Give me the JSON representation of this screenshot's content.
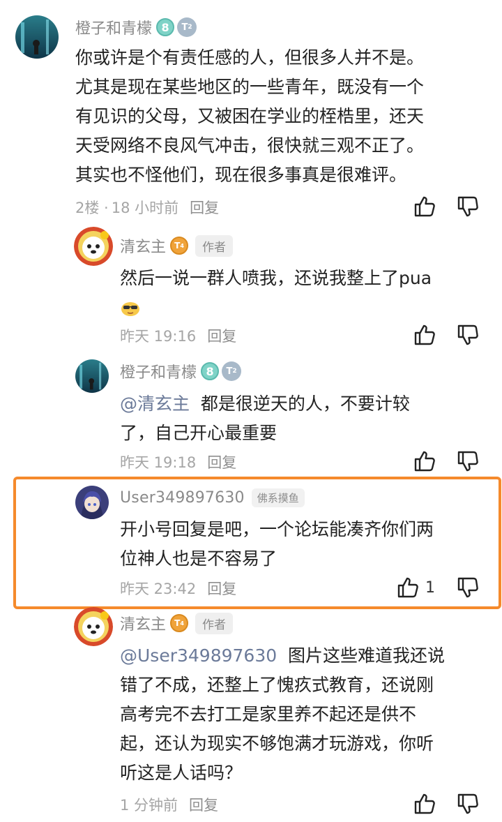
{
  "comments": [
    {
      "username": "橙子和青檬",
      "level": "8",
      "tier": "2",
      "lines": [
        "你或许是个有责任感的人，但很多人并不是。",
        "尤其是现在某些地区的一些青年，既没有一个",
        "有见识的父母，又被困在学业的桎梏里，还天",
        "天受网络不良风气冲击，很快就三观不正了。",
        "其实也不怪他们，现在很多事真是很难评。"
      ],
      "floor": "2楼 ·",
      "time": "18 小时前",
      "reply_label": "回复"
    },
    {
      "username": "清玄主",
      "level": "4",
      "author_tag": "作者",
      "lines": [
        "然后一说一群人喷我，还说我整上了pua"
      ],
      "time": "昨天 19:16",
      "reply_label": "回复"
    },
    {
      "username": "橙子和青檬",
      "level": "8",
      "tier": "2",
      "mention": "@清玄主",
      "lines": [
        "都是很逆天的人，不要计较",
        "了，自己开心最重要"
      ],
      "time": "昨天 19:18",
      "reply_label": "回复"
    },
    {
      "username": "User349897630",
      "group_tag": "佛系摸鱼",
      "lines": [
        "开小号回复是吧，一个论坛能凑齐你们两",
        "位神人也是不容易了"
      ],
      "time": "昨天 23:42",
      "reply_label": "回复",
      "like_count": "1"
    },
    {
      "username": "清玄主",
      "level": "4",
      "author_tag": "作者",
      "mention": "@User349897630",
      "lines": [
        "图片这些难道我还说",
        "错了不成，还整上了愧疚式教育，还说刚",
        "高考完不去打工是家里养不起还是供不",
        "起，还认为现实不够饱满才玩游戏，你听",
        "听这是人话吗？"
      ],
      "time": "1 分钟前",
      "reply_label": "回复"
    }
  ],
  "colors": {
    "highlight": "#f58a2c",
    "meta": "#a5a5a5",
    "username": "#8a8a8a"
  },
  "icons": [
    "thumbs-up-icon",
    "thumbs-down-icon",
    "level-badge-icon",
    "tier-badge-icon",
    "sunglasses-emoji-icon"
  ]
}
